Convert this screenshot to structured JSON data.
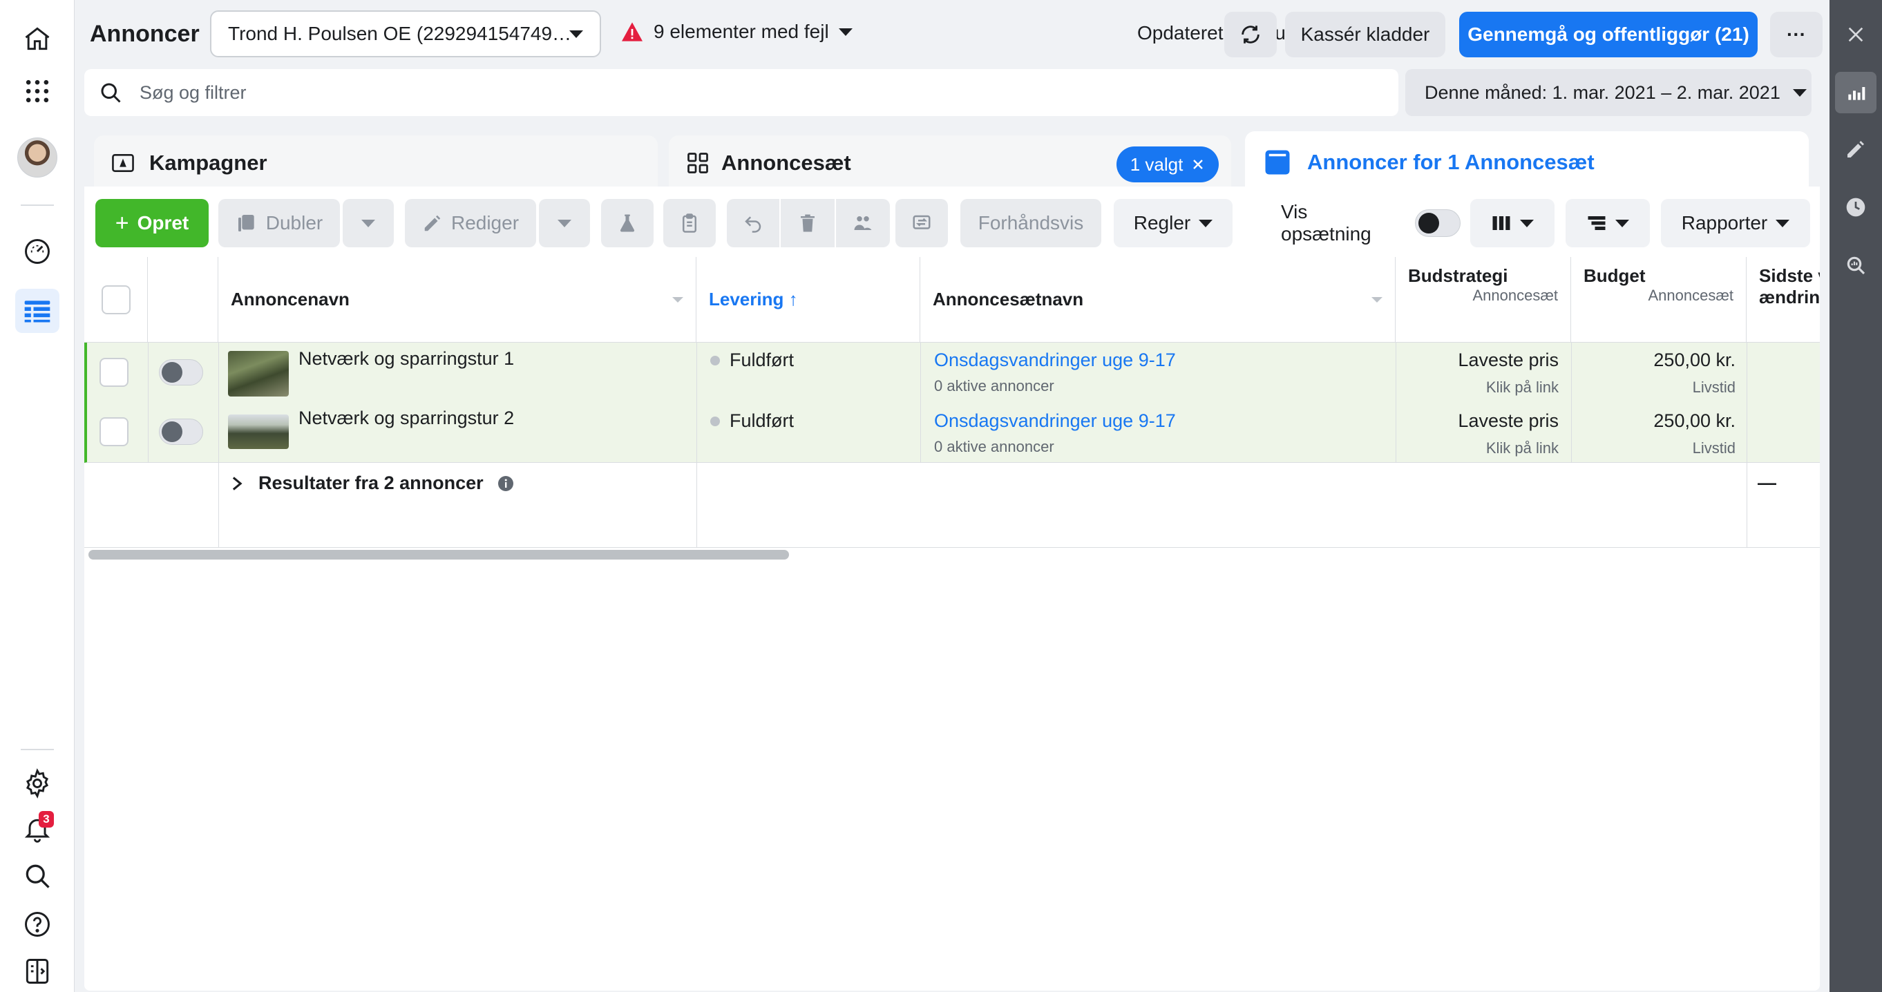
{
  "app": {
    "title": "Annoncer",
    "account_selector": "Trond H. Poulsen OE (229294154749…",
    "errors": "9 elementer med fejl",
    "updated": "Opdateret lige nu",
    "discard_drafts": "Kassér kladder",
    "review_publish": "Gennemgå og offentliggør (21)",
    "more": "···"
  },
  "search": {
    "placeholder": "Søg og filtrer",
    "date_range": "Denne måned: 1. mar. 2021 – 2. mar. 2021"
  },
  "leftnav": {
    "notification_count": "3"
  },
  "tabs": {
    "campaigns": "Kampagner",
    "adsets": "Annoncesæt",
    "adsets_chip": "1 valgt",
    "ads": "Annoncer for 1 Annoncesæt"
  },
  "toolbar": {
    "create": "Opret",
    "duplicate": "Dubler",
    "edit": "Rediger",
    "preview": "Forhåndsvis",
    "rules": "Regler",
    "view_setup": "Vis opsætning",
    "reports": "Rapporter"
  },
  "table": {
    "headers": {
      "ad_name": "Annoncenavn",
      "delivery": "Levering ↑",
      "adset_name": "Annoncesætnavn",
      "bid_strategy": "Budstrategi",
      "bid_strategy_sub": "Annoncesæt",
      "budget": "Budget",
      "budget_sub": "Annoncesæt",
      "last_change_1": "Sidste v",
      "last_change_2": "ændring"
    },
    "rows": [
      {
        "name": "Netværk og sparringstur 1",
        "delivery": "Fuldført",
        "adset": "Onsdagsvandringer uge 9-17",
        "adset_sub": "0 aktive annoncer",
        "bid": "Laveste pris",
        "bid_sub": "Klik på link",
        "budget": "250,00 kr.",
        "budget_sub": "Livstid"
      },
      {
        "name": "Netværk og sparringstur 2",
        "delivery": "Fuldført",
        "adset": "Onsdagsvandringer uge 9-17",
        "adset_sub": "0 aktive annoncer",
        "bid": "Laveste pris",
        "bid_sub": "Klik på link",
        "budget": "250,00 kr.",
        "budget_sub": "Livstid"
      }
    ],
    "results_label": "Resultater fra 2 annoncer",
    "results_dash": "—"
  },
  "colors": {
    "accent": "#1877f2",
    "create_green": "#42b72a",
    "selected_row_bg": "#eef5e8",
    "selected_row_border": "#42b72a",
    "error_red": "#e41e3f"
  }
}
